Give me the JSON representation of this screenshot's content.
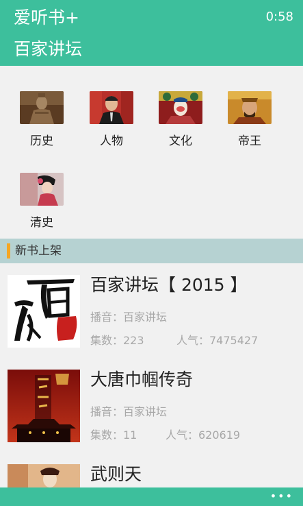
{
  "header": {
    "app_title": "爱听书+",
    "clock": "0:58",
    "page_title": "百家讲坛"
  },
  "categories": [
    {
      "label": "历史"
    },
    {
      "label": "人物"
    },
    {
      "label": "文化"
    },
    {
      "label": "帝王"
    },
    {
      "label": "清史"
    }
  ],
  "section": {
    "label": "新书上架"
  },
  "books": [
    {
      "title": "百家讲坛【 2015 】",
      "narrator": "播音：百家讲坛",
      "count": "集数：223",
      "popularity": "人气：7475427",
      "cover_text": "百 家",
      "cover_seal": "讲坛"
    },
    {
      "title": "大唐巾帼传奇",
      "narrator": "播音：百家讲坛",
      "count": "集数：11",
      "popularity": "人气：620619",
      "cover_text": "大唐巾帼传奇"
    },
    {
      "title": "武则天"
    }
  ],
  "appbar": {
    "more": "•••"
  },
  "colors": {
    "accent": "#3dbf9c",
    "section_bg": "#b6d2d2",
    "section_marker": "#f5a623"
  }
}
